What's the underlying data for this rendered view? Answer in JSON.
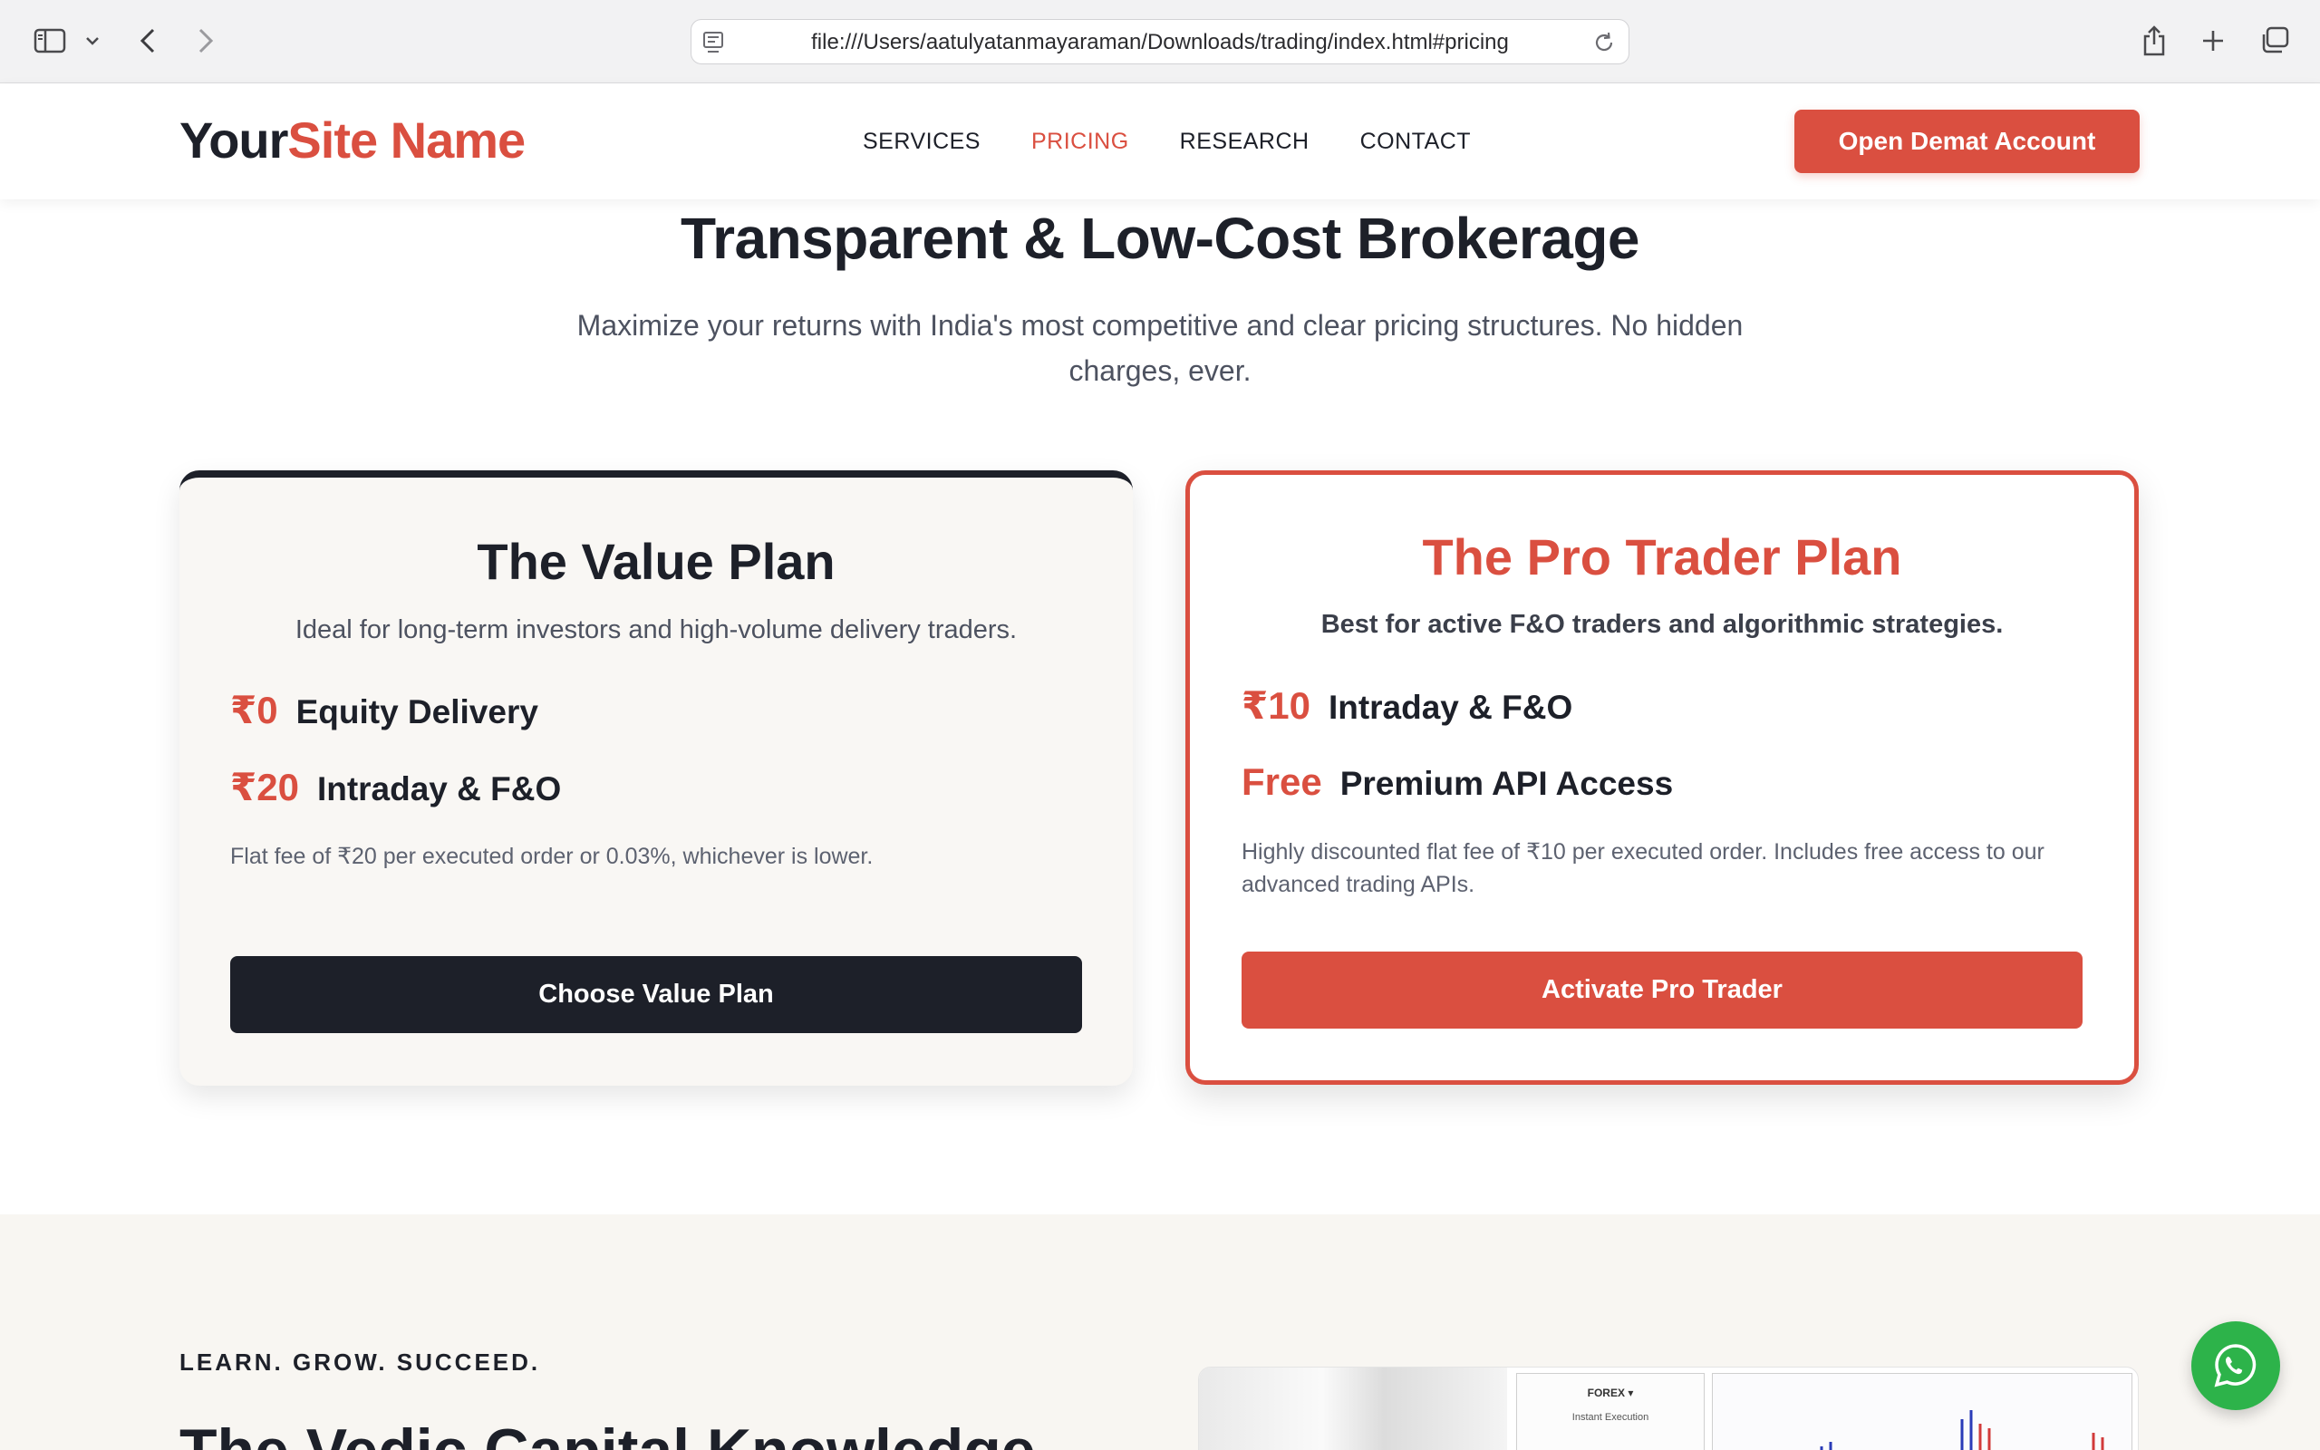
{
  "browser": {
    "url": "file:///Users/aatulyatanmayaraman/Downloads/trading/index.html#pricing"
  },
  "header": {
    "logo_part1": "Your",
    "logo_part2": "Site Name",
    "nav": [
      {
        "label": "SERVICES",
        "active": false
      },
      {
        "label": "PRICING",
        "active": true
      },
      {
        "label": "RESEARCH",
        "active": false
      },
      {
        "label": "CONTACT",
        "active": false
      }
    ],
    "cta_label": "Open Demat Account"
  },
  "pricing": {
    "title": "Transparent & Low-Cost Brokerage",
    "subtitle": "Maximize your returns with India's most competitive and clear pricing structures. No hidden charges, ever.",
    "plans": [
      {
        "name": "The Value Plan",
        "description": "Ideal for long-term investors and high-volume delivery traders.",
        "features": [
          {
            "price": "₹0",
            "label": "Equity Delivery"
          },
          {
            "price": "₹20",
            "label": "Intraday & F&O"
          }
        ],
        "note": "Flat fee of ₹20 per executed order or 0.03%, whichever is lower.",
        "button": "Choose Value Plan"
      },
      {
        "name": "The Pro Trader Plan",
        "description": "Best for active F&O traders and algorithmic strategies.",
        "features": [
          {
            "price": "₹10",
            "label": "Intraday & F&O"
          },
          {
            "price": "Free",
            "label": "Premium API Access"
          }
        ],
        "note": "Highly discounted flat fee of ₹10 per executed order. Includes free access to our advanced trading APIs.",
        "button": "Activate Pro Trader"
      }
    ]
  },
  "knowledge": {
    "eyebrow": "LEARN. GROW. SUCCEED.",
    "title": "The Vedic Capital Knowledge",
    "image_panel_title": "FOREX ▾",
    "image_panel_sub": "Instant Execution"
  },
  "colors": {
    "accent": "#da4f40",
    "dark": "#1d2029",
    "whatsapp": "#2db34a"
  },
  "icons": [
    "sidebar-icon",
    "chevron-down-icon",
    "back-icon",
    "forward-icon",
    "page-icon",
    "reload-icon",
    "share-icon",
    "plus-icon",
    "tabs-icon",
    "whatsapp-icon"
  ]
}
